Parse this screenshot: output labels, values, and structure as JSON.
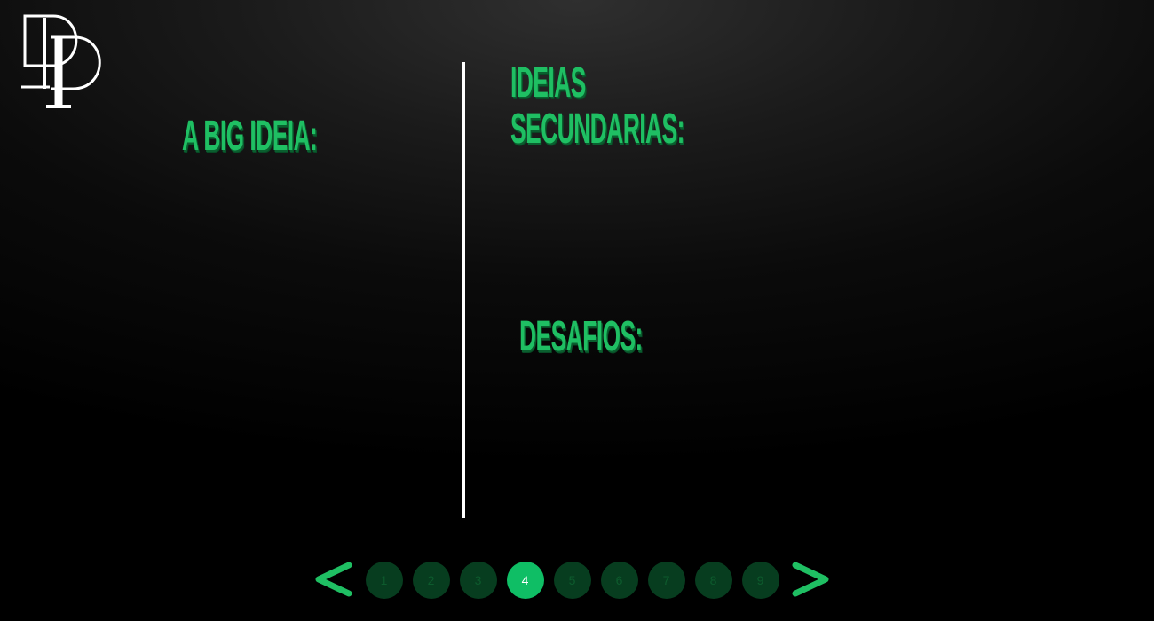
{
  "brand": {
    "logo_icon": "dp-monogram-logo",
    "accent_color": "#1fbf63"
  },
  "slide": {
    "big_idea_title": "A BIG IDEIA:",
    "secondary_title_line1": "IDEIAS",
    "secondary_title_line2": "SECUNDARIAS:",
    "challenges_title": "DESAFIOS:"
  },
  "pagination": {
    "prev_icon": "chevron-left-icon",
    "next_icon": "chevron-right-icon",
    "pages": [
      "1",
      "2",
      "3",
      "4",
      "5",
      "6",
      "7",
      "8",
      "9"
    ],
    "current_page": "4",
    "active_color": "#0fbe65",
    "inactive_color": "#073d1f"
  }
}
